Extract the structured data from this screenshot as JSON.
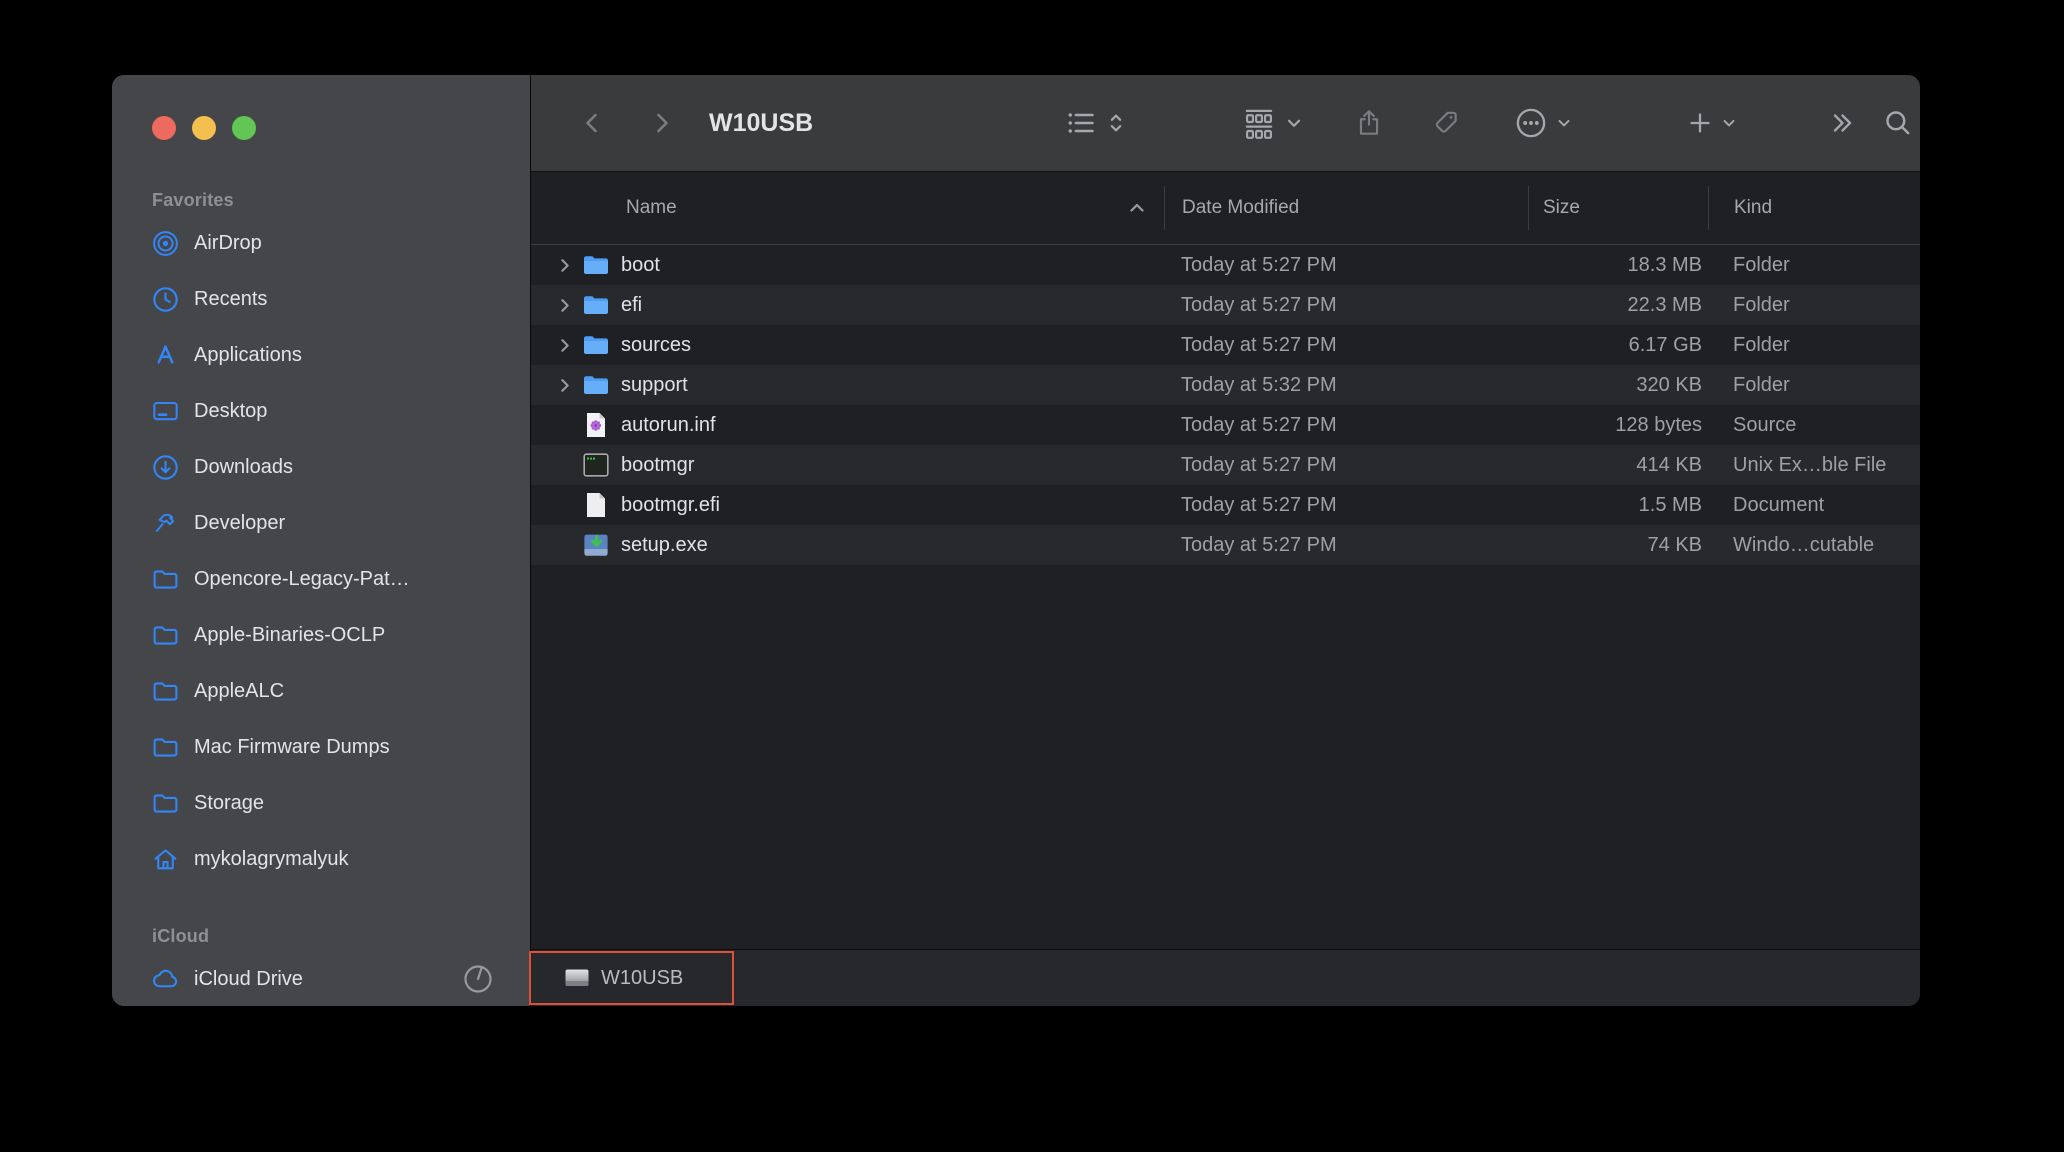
{
  "window": {
    "title": "W10USB"
  },
  "toolbar": {
    "buttons": [
      "back-button",
      "forward-button",
      "view-options-button",
      "group-button",
      "share-button",
      "tag-button",
      "more-actions-button",
      "add-button",
      "toolbar-overflow-button",
      "search-button"
    ]
  },
  "sidebar": {
    "sections": [
      {
        "label": "Favorites",
        "items": [
          {
            "label": "AirDrop",
            "icon": "airdrop-icon"
          },
          {
            "label": "Recents",
            "icon": "clock-icon"
          },
          {
            "label": "Applications",
            "icon": "app-store-icon"
          },
          {
            "label": "Desktop",
            "icon": "desktop-icon"
          },
          {
            "label": "Downloads",
            "icon": "download-circle-icon"
          },
          {
            "label": "Developer",
            "icon": "hammer-icon"
          },
          {
            "label": "Opencore-Legacy-Pat…",
            "icon": "folder-icon"
          },
          {
            "label": "Apple-Binaries-OCLP",
            "icon": "folder-icon"
          },
          {
            "label": "AppleALC",
            "icon": "folder-icon"
          },
          {
            "label": "Mac Firmware Dumps",
            "icon": "folder-icon"
          },
          {
            "label": "Storage",
            "icon": "folder-icon"
          },
          {
            "label": "mykolagrymalyuk",
            "icon": "home-icon"
          }
        ]
      },
      {
        "label": "iCloud",
        "items": [
          {
            "label": "iCloud Drive",
            "icon": "cloud-icon",
            "status_icon": "sync-progress-icon"
          }
        ]
      }
    ]
  },
  "list": {
    "columns": [
      {
        "label": "Name",
        "sort": "asc"
      },
      {
        "label": "Date Modified"
      },
      {
        "label": "Size"
      },
      {
        "label": "Kind"
      }
    ],
    "rows": [
      {
        "name": "boot",
        "icon": "folder-file-icon",
        "disclosure": true,
        "date_modified": "Today at 5:27 PM",
        "size": "18.3 MB",
        "kind": "Folder"
      },
      {
        "name": "efi",
        "icon": "folder-file-icon",
        "disclosure": true,
        "date_modified": "Today at 5:27 PM",
        "size": "22.3 MB",
        "kind": "Folder"
      },
      {
        "name": "sources",
        "icon": "folder-file-icon",
        "disclosure": true,
        "date_modified": "Today at 5:27 PM",
        "size": "6.17 GB",
        "kind": "Folder"
      },
      {
        "name": "support",
        "icon": "folder-file-icon",
        "disclosure": true,
        "date_modified": "Today at 5:32 PM",
        "size": "320 KB",
        "kind": "Folder"
      },
      {
        "name": "autorun.inf",
        "icon": "inf-file-icon",
        "disclosure": false,
        "date_modified": "Today at 5:27 PM",
        "size": "128 bytes",
        "kind": "Source"
      },
      {
        "name": "bootmgr",
        "icon": "executable-file-icon",
        "disclosure": false,
        "date_modified": "Today at 5:27 PM",
        "size": "414 KB",
        "kind": "Unix Ex…ble File"
      },
      {
        "name": "bootmgr.efi",
        "icon": "document-file-icon",
        "disclosure": false,
        "date_modified": "Today at 5:27 PM",
        "size": "1.5 MB",
        "kind": "Document"
      },
      {
        "name": "setup.exe",
        "icon": "windows-exe-icon",
        "disclosure": false,
        "date_modified": "Today at 5:27 PM",
        "size": "74 KB",
        "kind": "Windo…cutable"
      }
    ]
  },
  "pathbar": {
    "items": [
      {
        "label": "W10USB",
        "icon": "disk-icon",
        "highlighted": true
      }
    ]
  },
  "colors": {
    "accent_blue": "#3286f7",
    "annotation_red": "#dd4f38",
    "traffic_close": "#ec6a5e",
    "traffic_minimize": "#f5bf4f",
    "traffic_maximize": "#62c554",
    "sidebar_bg": "#454649",
    "toolbar_bg": "#3a3b3d",
    "content_bg": "#1e2023",
    "row_alt_bg": "#28292c",
    "pathbar_bg": "#27282b"
  }
}
